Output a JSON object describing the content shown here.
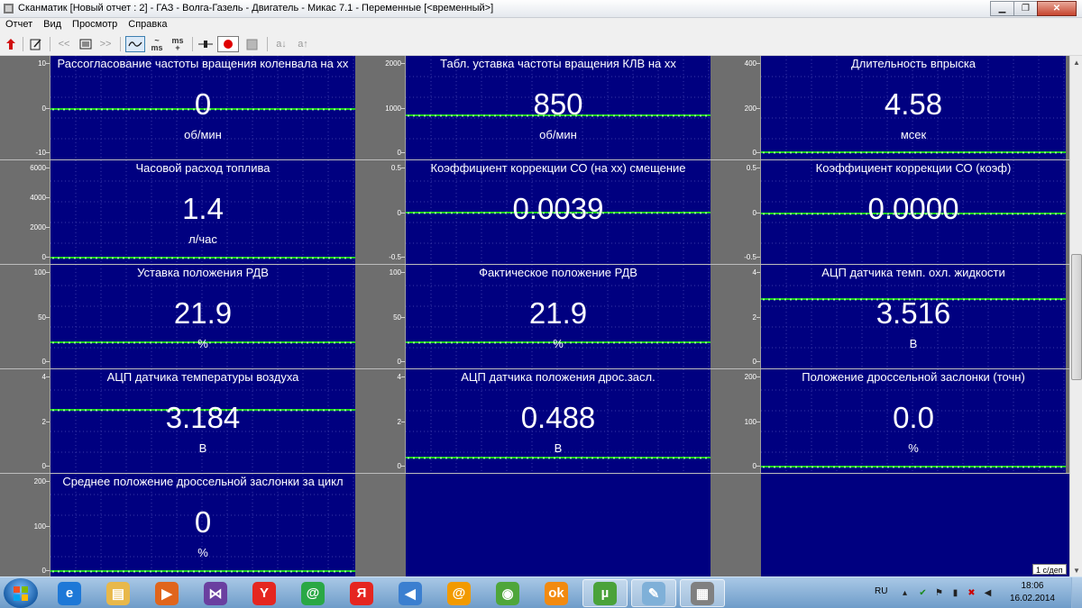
{
  "window": {
    "title": "Сканматик [Новый отчет : 2] - ГАЗ - Волга-Газель - Двигатель - Микас 7.1 - Переменные [<временный>]",
    "app_icon": "scanmatic-icon",
    "buttons": [
      "minimize",
      "maximize",
      "close"
    ]
  },
  "menu": [
    "Отчет",
    "Вид",
    "Просмотр",
    "Справка"
  ],
  "toolbar": {
    "ms_label": "ms",
    "ms_plus_label": "ms",
    "plus_sign": "+",
    "font_down_label": "a↓",
    "font_up_label": "a↑",
    "nav_prev_prev": "<<",
    "nav_next_next": ">>"
  },
  "panels": [
    {
      "title": "Рассогласование частоты вращения коленвала на хх",
      "value": "0",
      "unit": "об/мин",
      "ticks": [
        "10",
        "0",
        "-10"
      ],
      "level": 0.5
    },
    {
      "title": "Табл. уставка частоты вращения КЛВ на хх",
      "value": "850",
      "unit": "об/мин",
      "ticks": [
        "2000",
        "1000",
        "0"
      ],
      "level": 0.425
    },
    {
      "title": "Длительность впрыска",
      "value": "4.58",
      "unit": "мсек",
      "ticks": [
        "400",
        "200",
        "0"
      ],
      "level": 0.0115
    },
    {
      "title": "Часовой расход топлива",
      "value": "1.4",
      "unit": "л/час",
      "ticks": [
        "6000",
        "4000",
        "2000",
        "0"
      ],
      "level": 0.0002
    },
    {
      "title": "Коэффициент коррекции СО (на хх) смещение",
      "value": "0.0039",
      "unit": "",
      "ticks": [
        "0.5",
        "0",
        "-0.5"
      ],
      "level": 0.5039
    },
    {
      "title": "Коэффициент коррекции СО (коэф)",
      "value": "0.0000",
      "unit": "",
      "ticks": [
        "0.5",
        "0",
        "-0.5"
      ],
      "level": 0.5
    },
    {
      "title": "Уставка положения РДВ",
      "value": "21.9",
      "unit": "%",
      "ticks": [
        "100",
        "50",
        "0"
      ],
      "level": 0.219
    },
    {
      "title": "Фактическое положение РДВ",
      "value": "21.9",
      "unit": "%",
      "ticks": [
        "100",
        "50",
        "0"
      ],
      "level": 0.219
    },
    {
      "title": "АЦП датчика темп. охл. жидкости",
      "value": "3.516",
      "unit": "В",
      "ticks": [
        "4",
        "2",
        "0"
      ],
      "level": 0.703
    },
    {
      "title": "АЦП датчика температуры воздуха",
      "value": "3.184",
      "unit": "В",
      "ticks": [
        "4",
        "2",
        "0"
      ],
      "level": 0.637
    },
    {
      "title": "АЦП датчика положения дрос.засл.",
      "value": "0.488",
      "unit": "В",
      "ticks": [
        "4",
        "2",
        "0"
      ],
      "level": 0.098
    },
    {
      "title": "Положение дроссельной заслонки (точн)",
      "value": "0.0",
      "unit": "%",
      "ticks": [
        "200",
        "100",
        "0"
      ],
      "level": 0
    },
    {
      "title": "Среднее положение дроссельной заслонки за цикл",
      "value": "0",
      "unit": "%",
      "ticks": [
        "200",
        "100",
        "0"
      ],
      "level": 0
    }
  ],
  "rate_badge": "1 с/деп",
  "taskbar": {
    "apps": [
      "ie-icon",
      "explorer-icon",
      "media-player-icon",
      "visual-studio-icon",
      "yandex-browser-icon",
      "mail-agent-icon",
      "yandex-icon",
      "volume-app-icon",
      "mail-ru-icon",
      "chrome-like-icon",
      "odnoklassniki-icon",
      "utorrent-icon",
      "notes-icon",
      "scanmatic-task-icon"
    ],
    "lang": "RU",
    "time": "18:06",
    "date": "16.02.2014"
  },
  "colors": {
    "plot_bg": "#000080",
    "axis_bg": "#6e6e6e",
    "trace": "#1fd01f",
    "text": "#ffffff"
  }
}
